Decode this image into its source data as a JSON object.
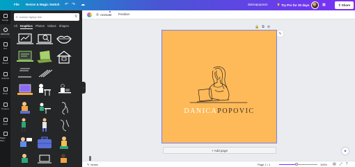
{
  "topbar": {
    "file_label": "File",
    "resize_label": "Resize & Magic Switch",
    "undo_icon": "↶",
    "redo_icon": "↷",
    "cloud_icon": "☁",
    "doc_title": "danicapopovic",
    "try_pro_label": "Try Pro for 30 days",
    "try_pro_icon": "♛",
    "stats_icon": "▦",
    "share_label": "Share",
    "share_icon": "⇧"
  },
  "rail": {
    "items": [
      {
        "label": "Design"
      },
      {
        "label": "Elements"
      },
      {
        "label": "Text"
      },
      {
        "label": "Brand"
      },
      {
        "label": "Uploads"
      },
      {
        "label": "Draw"
      },
      {
        "label": "Projects"
      },
      {
        "label": "Apps"
      },
      {
        "label": "Magic Med..."
      }
    ]
  },
  "panel": {
    "search_placeholder": "woman laptop line",
    "search_icon": "⌕",
    "filter_icon": "⚲",
    "tabs": [
      "All",
      "Graphics",
      "Photos",
      "Videos",
      "Shapes"
    ],
    "collapse_icon": "‹"
  },
  "context": {
    "animate_label": "Animate",
    "animate_icon": "◎",
    "position_label": "Position"
  },
  "canvas": {
    "brand_part1": "DANICA",
    "brand_part2": "POPOVIC",
    "page_icons": [
      "🔒",
      "⧉",
      "⊕"
    ],
    "note_icon": "✎",
    "add_page_label": "+ Add page",
    "magic_icon": "✦",
    "background_color": "#feba58",
    "selection_color": "#7b7ef0"
  },
  "footer": {
    "notes_label": "Notes",
    "notes_icon": "✎",
    "pages_label": "Page 1 / 1",
    "zoom_label": "115%",
    "zoom_fraction": 0.46,
    "icons": [
      "▤",
      "⤢",
      "?"
    ]
  }
}
